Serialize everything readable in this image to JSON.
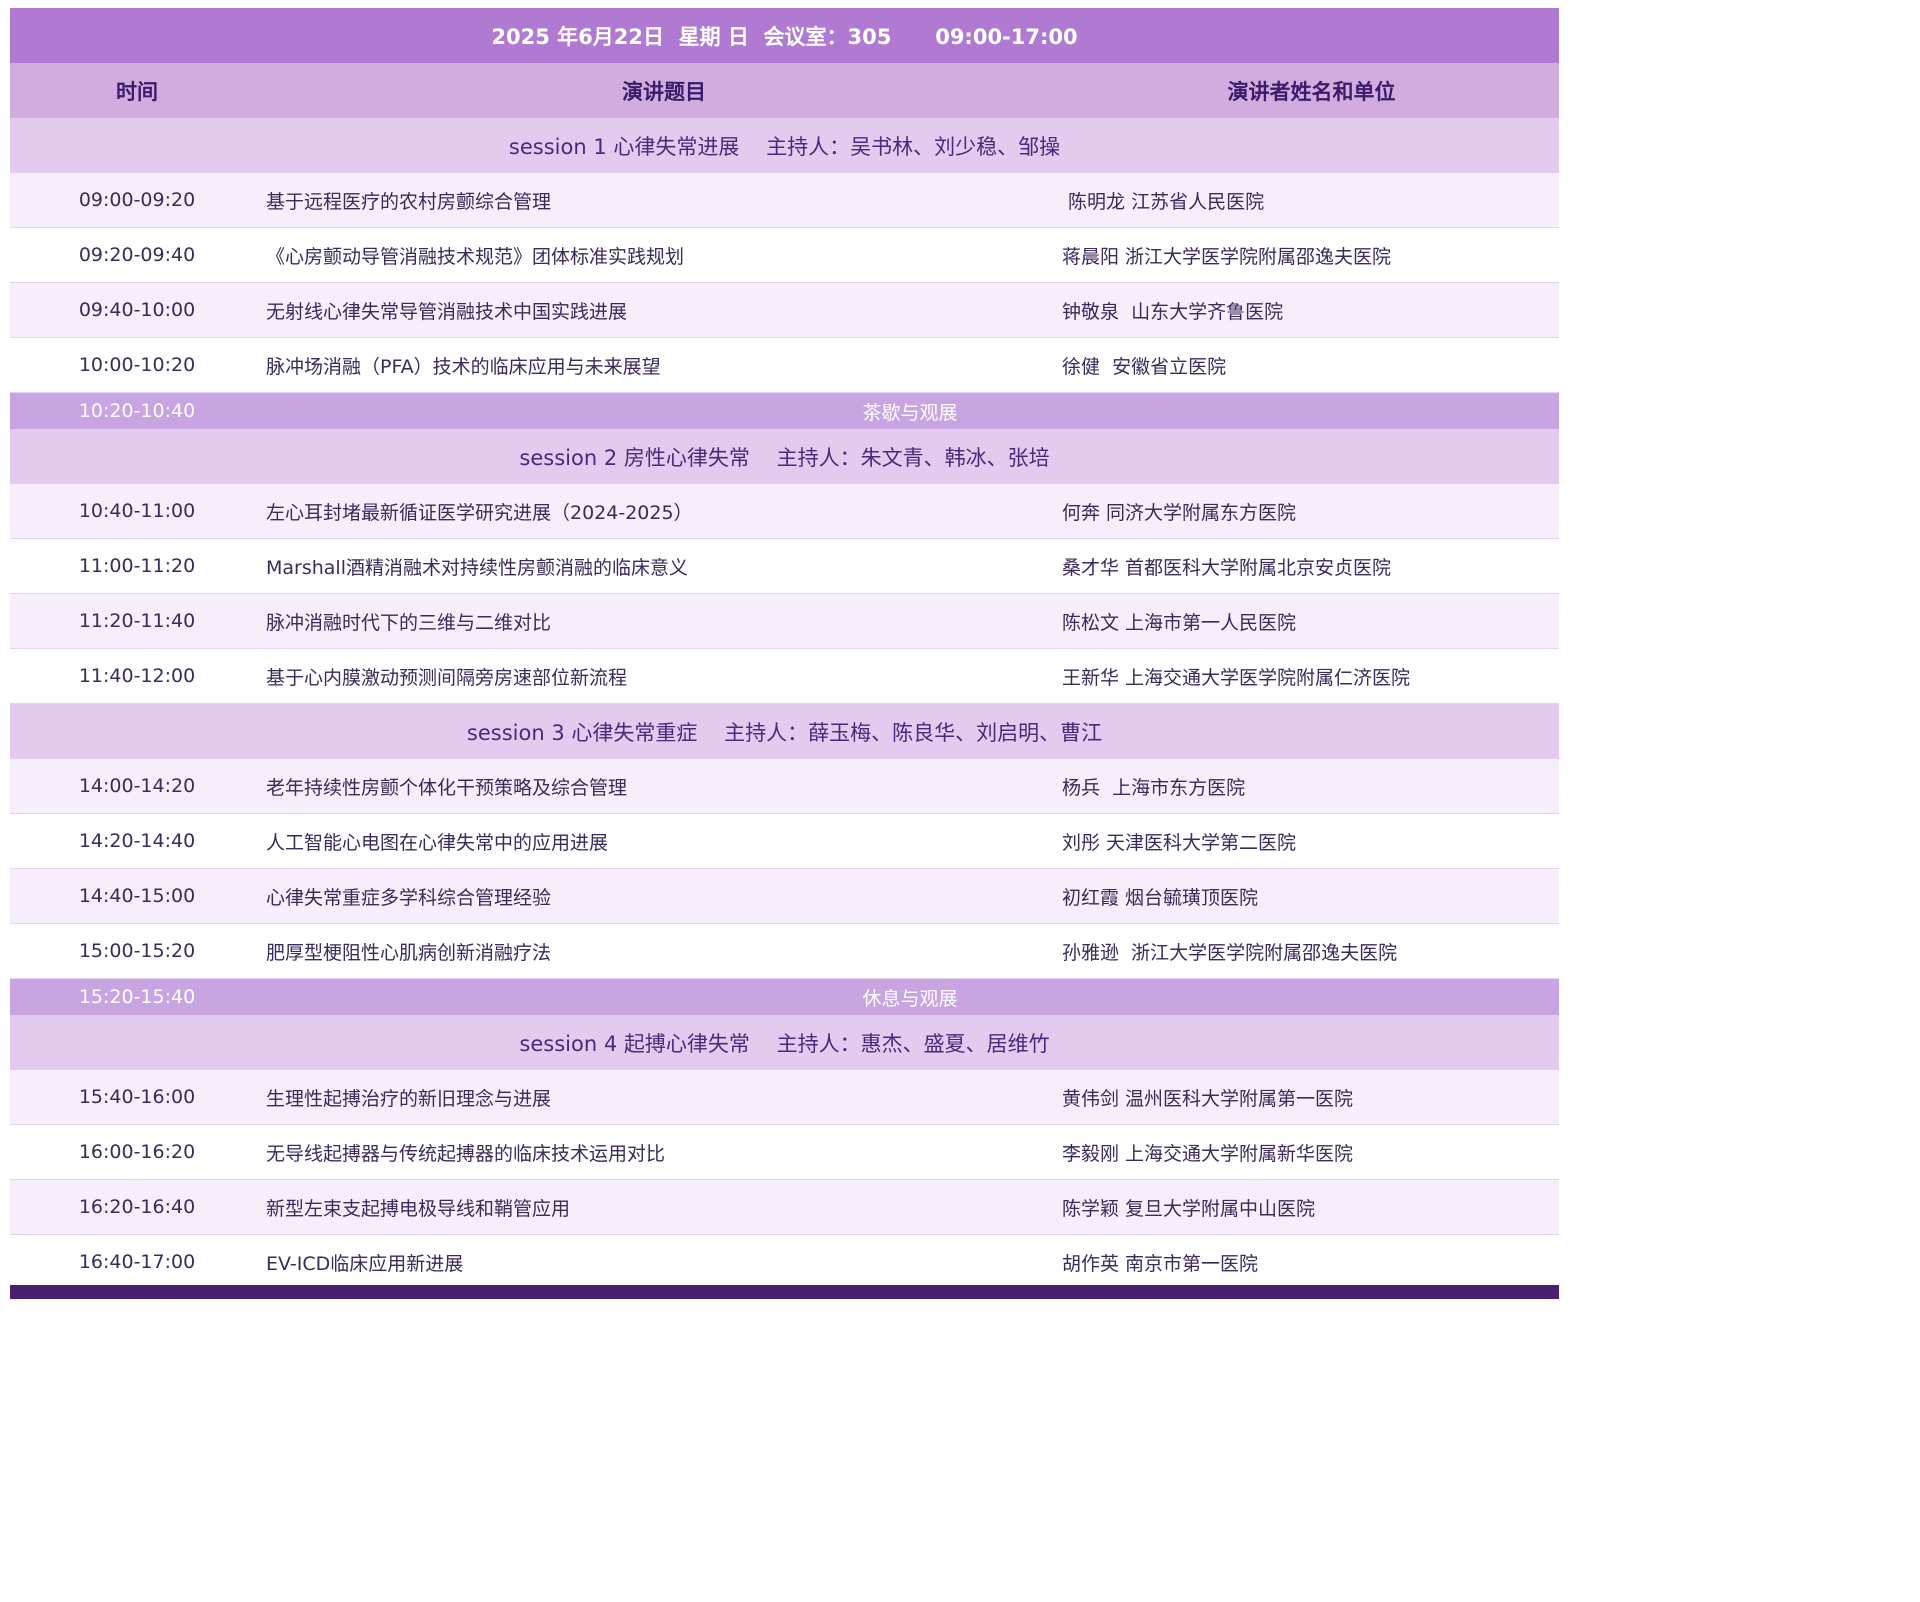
{
  "title": "2025 年6月22日  星期 日  会议室：305      09:00-17:00",
  "header": {
    "time": "时间",
    "topic": "演讲题目",
    "speaker": "演讲者姓名和单位"
  },
  "blocks": [
    {
      "type": "session",
      "label": "session 1 心律失常进展    主持人：吴书林、刘少稳、邹操"
    },
    {
      "type": "talk",
      "time": "09:00-09:20",
      "topic": "基于远程医疗的农村房颤综合管理",
      "speaker": " 陈明龙 江苏省人民医院"
    },
    {
      "type": "talk",
      "time": "09:20-09:40",
      "topic": "《心房颤动导管消融技术规范》团体标准实践规划",
      "speaker": "蒋晨阳 浙江大学医学院附属邵逸夫医院"
    },
    {
      "type": "talk",
      "time": "09:40-10:00",
      "topic": "无射线心律失常导管消融技术中国实践进展",
      "speaker": "钟敬泉  山东大学齐鲁医院"
    },
    {
      "type": "talk",
      "time": "10:00-10:20",
      "topic": "脉冲场消融（PFA）技术的临床应用与未来展望",
      "speaker": "徐健  安徽省立医院"
    },
    {
      "type": "break",
      "time": "10:20-10:40",
      "label": "茶歇与观展"
    },
    {
      "type": "session",
      "label": "session 2 房性心律失常    主持人：朱文青、韩冰、张培"
    },
    {
      "type": "talk",
      "time": "10:40-11:00",
      "topic": "左心耳封堵最新循证医学研究进展（2024-2025）",
      "speaker": "何奔 同济大学附属东方医院"
    },
    {
      "type": "talk",
      "time": "11:00-11:20",
      "topic": "Marshall酒精消融术对持续性房颤消融的临床意义",
      "speaker": "桑才华 首都医科大学附属北京安贞医院"
    },
    {
      "type": "talk",
      "time": "11:20-11:40",
      "topic": "脉冲消融时代下的三维与二维对比",
      "speaker": "陈松文 上海市第一人民医院"
    },
    {
      "type": "talk",
      "time": "11:40-12:00",
      "topic": "基于心内膜激动预测间隔旁房速部位新流程",
      "speaker": "王新华 上海交通大学医学院附属仁济医院"
    },
    {
      "type": "session",
      "label": "session 3 心律失常重症    主持人：薛玉梅、陈良华、刘启明、曹江"
    },
    {
      "type": "talk",
      "time": "14:00-14:20",
      "topic": "老年持续性房颤个体化干预策略及综合管理",
      "speaker": "杨兵  上海市东方医院"
    },
    {
      "type": "talk",
      "time": "14:20-14:40",
      "topic": "人工智能心电图在心律失常中的应用进展",
      "speaker": "刘彤 天津医科大学第二医院"
    },
    {
      "type": "talk",
      "time": "14:40-15:00",
      "topic": "心律失常重症多学科综合管理经验",
      "speaker": "初红霞 烟台毓璜顶医院"
    },
    {
      "type": "talk",
      "time": "15:00-15:20",
      "topic": "肥厚型梗阻性心肌病创新消融疗法",
      "speaker": "孙雅逊  浙江大学医学院附属邵逸夫医院"
    },
    {
      "type": "break",
      "time": "15:20-15:40",
      "label": "休息与观展"
    },
    {
      "type": "session",
      "label": "session 4 起搏心律失常    主持人：惠杰、盛夏、居维竹"
    },
    {
      "type": "talk",
      "time": "15:40-16:00",
      "topic": "生理性起搏治疗的新旧理念与进展",
      "speaker": "黄伟剑 温州医科大学附属第一医院"
    },
    {
      "type": "talk",
      "time": "16:00-16:20",
      "topic": "无导线起搏器与传统起搏器的临床技术运用对比",
      "speaker": "李毅刚 上海交通大学附属新华医院"
    },
    {
      "type": "talk",
      "time": "16:20-16:40",
      "topic": "新型左束支起搏电极导线和鞘管应用",
      "speaker": "陈学颖 复旦大学附属中山医院"
    },
    {
      "type": "talk",
      "time": "16:40-17:00",
      "topic": "EV-ICD临床应用新进展",
      "speaker": "胡作英 南京市第一医院"
    }
  ]
}
